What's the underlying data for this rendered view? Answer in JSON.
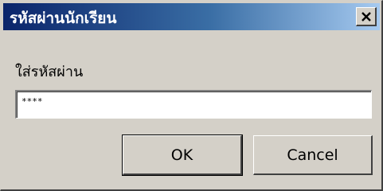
{
  "window": {
    "title": "รหัสผ่านนักเรียน",
    "close_icon": "close-icon"
  },
  "dialog": {
    "prompt_label": "ใส่รหัสผ่าน",
    "password_value": "****"
  },
  "buttons": {
    "ok_label": "OK",
    "cancel_label": "Cancel"
  },
  "colors": {
    "titlebar_start": "#0a246a",
    "titlebar_end": "#a6caf0",
    "face": "#d4d0c8"
  }
}
